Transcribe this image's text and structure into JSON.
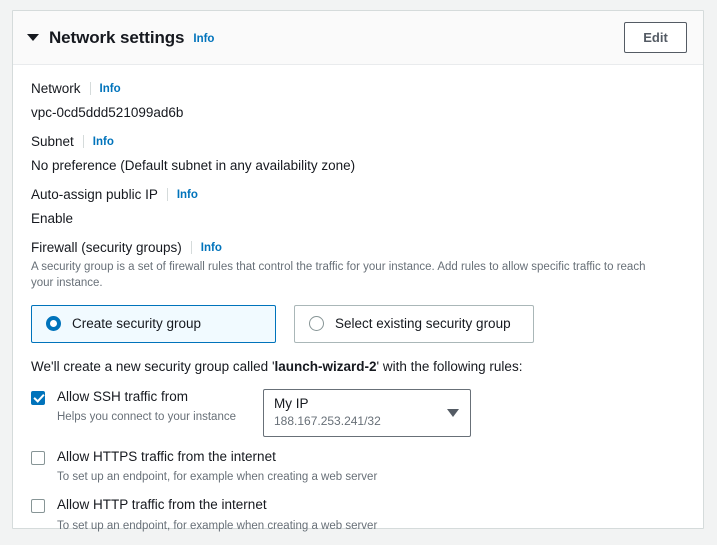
{
  "header": {
    "title": "Network settings",
    "info_label": "Info",
    "edit_label": "Edit",
    "caret_icon": "caret-down-icon"
  },
  "fields": {
    "network": {
      "label": "Network",
      "info_label": "Info",
      "value": "vpc-0cd5ddd521099ad6b"
    },
    "subnet": {
      "label": "Subnet",
      "info_label": "Info",
      "value": "No preference (Default subnet in any availability zone)"
    },
    "auto_assign_ip": {
      "label": "Auto-assign public IP",
      "info_label": "Info",
      "value": "Enable"
    }
  },
  "firewall": {
    "label": "Firewall (security groups)",
    "info_label": "Info",
    "description": "A security group is a set of firewall rules that control the traffic for your instance. Add rules to allow specific traffic to reach your instance.",
    "options": [
      {
        "label": "Create security group",
        "selected": true
      },
      {
        "label": "Select existing security group",
        "selected": false
      }
    ],
    "sentence_prefix": "We'll create a new security group called '",
    "security_group_name": "launch-wizard-2",
    "sentence_suffix": "' with the following rules:"
  },
  "rules": [
    {
      "title": "Allow SSH traffic from",
      "subtitle": "Helps you connect to your instance",
      "checked": true,
      "source": {
        "value": "My IP",
        "detail": "188.167.253.241/32",
        "arrow_icon": "caret-down-icon"
      }
    },
    {
      "title": "Allow HTTPS traffic from the internet",
      "subtitle": "To set up an endpoint, for example when creating a web server",
      "checked": false
    },
    {
      "title": "Allow HTTP traffic from the internet",
      "subtitle": "To set up an endpoint, for example when creating a web server",
      "checked": false
    }
  ],
  "colors": {
    "accent": "#0073bb",
    "selected_tile_bg": "#f1faff",
    "text": "#16191f",
    "muted_text": "#687078",
    "border": "#d5dbdb"
  }
}
